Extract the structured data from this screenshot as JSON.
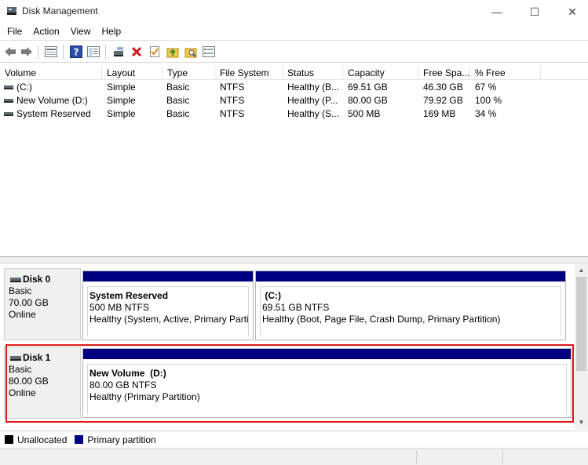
{
  "window": {
    "title": "Disk Management",
    "min_glyph": "—",
    "max_glyph": "☐",
    "close_glyph": "✕"
  },
  "menu": [
    "File",
    "Action",
    "View",
    "Help"
  ],
  "toolbar": {
    "icons": [
      "back-icon",
      "forward-icon",
      "list-view-icon",
      "help-icon",
      "properties-view-icon",
      "connect-drive-icon",
      "delete-icon",
      "check-icon",
      "folder-up-icon",
      "search-folder-icon",
      "settings-list-icon"
    ]
  },
  "columns": [
    "Volume",
    "Layout",
    "Type",
    "File System",
    "Status",
    "Capacity",
    "Free Spa...",
    "% Free"
  ],
  "volumes": [
    [
      "(C:)",
      "Simple",
      "Basic",
      "NTFS",
      "Healthy (B...",
      "69.51 GB",
      "46.30 GB",
      "67 %"
    ],
    [
      "New Volume (D:)",
      "Simple",
      "Basic",
      "NTFS",
      "Healthy (P...",
      "80.00 GB",
      "79.92 GB",
      "100 %"
    ],
    [
      "System Reserved",
      "Simple",
      "Basic",
      "NTFS",
      "Healthy (S...",
      "500 MB",
      "169 MB",
      "34 %"
    ]
  ],
  "disks": [
    {
      "name": "Disk 0",
      "type": "Basic",
      "size": "70.00 GB",
      "state": "Online",
      "partitions": [
        {
          "name": "System Reserved",
          "size": "500 MB NTFS",
          "status": "Healthy (System, Active, Primary Partit"
        },
        {
          "name": "(C:)",
          "size": "69.51 GB NTFS",
          "status": "Healthy (Boot, Page File, Crash Dump, Primary Partition)"
        }
      ]
    },
    {
      "name": "Disk 1",
      "type": "Basic",
      "size": "80.00 GB",
      "state": "Online",
      "partitions": [
        {
          "name": "New Volume  (D:)",
          "size": "80.00 GB NTFS",
          "status": "Healthy (Primary Partition)"
        }
      ]
    }
  ],
  "legend": [
    {
      "label": "Unallocated",
      "color": "#000000"
    },
    {
      "label": "Primary partition",
      "color": "#000080"
    }
  ],
  "colors": {
    "primary_partition": "#000080",
    "highlight": "#e0161a"
  }
}
